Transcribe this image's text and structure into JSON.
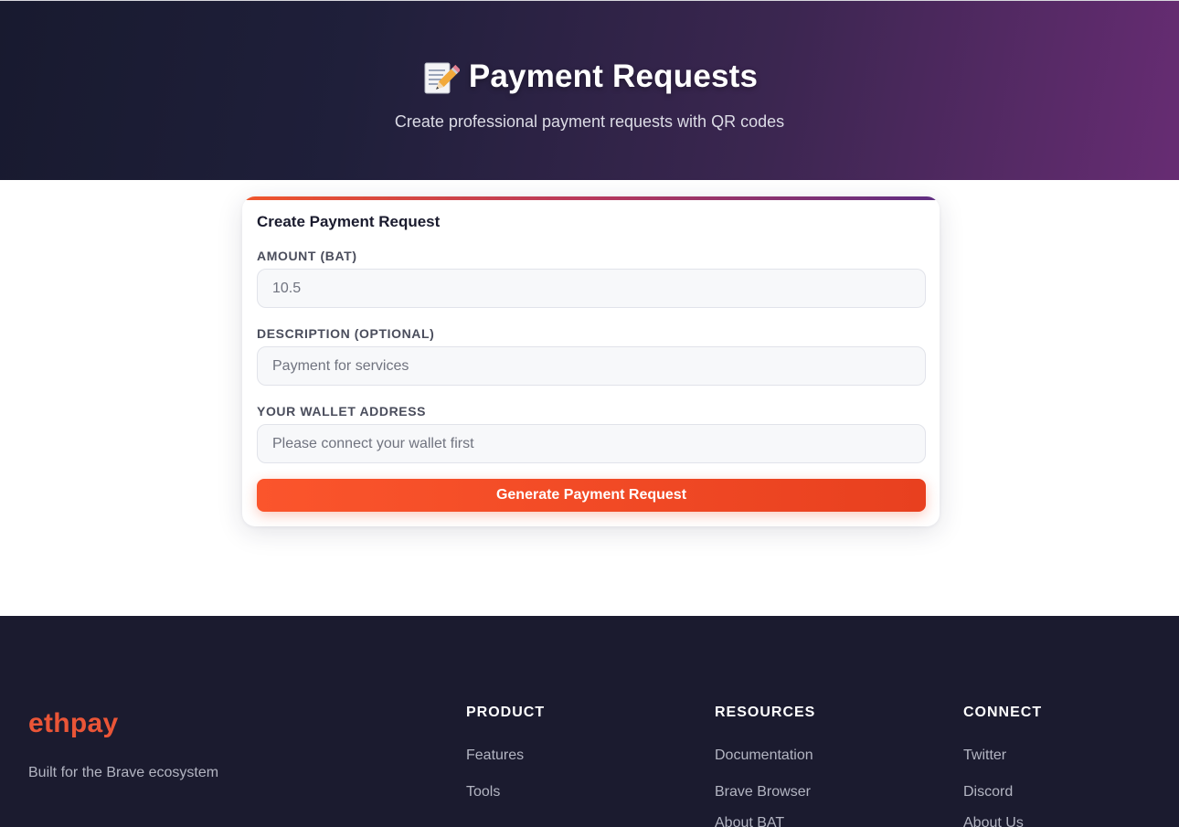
{
  "hero": {
    "icon": "pencil-memo-icon",
    "title": "Payment Requests",
    "subtitle": "Create professional payment requests with QR codes"
  },
  "form": {
    "title": "Create Payment Request",
    "amount_label": "AMOUNT (BAT)",
    "amount_placeholder": "10.5",
    "description_label": "DESCRIPTION (OPTIONAL)",
    "description_placeholder": "Payment for services",
    "wallet_label": "YOUR WALLET ADDRESS",
    "wallet_placeholder": "Please connect your wallet first",
    "submit_label": "Generate Payment Request"
  },
  "footer": {
    "logo": "ethpay",
    "tagline": "Built for the Brave ecosystem",
    "columns": [
      {
        "heading": "PRODUCT",
        "links": [
          "Features",
          "Tools"
        ]
      },
      {
        "heading": "RESOURCES",
        "links": [
          "Documentation",
          "Brave Browser",
          "About BAT"
        ]
      },
      {
        "heading": "CONNECT",
        "links": [
          "Twitter",
          "Discord",
          "About Us"
        ]
      }
    ]
  },
  "colors": {
    "accent": "#fb552c",
    "footer_bg": "#1b1b2f",
    "logo": "#ea5537"
  }
}
